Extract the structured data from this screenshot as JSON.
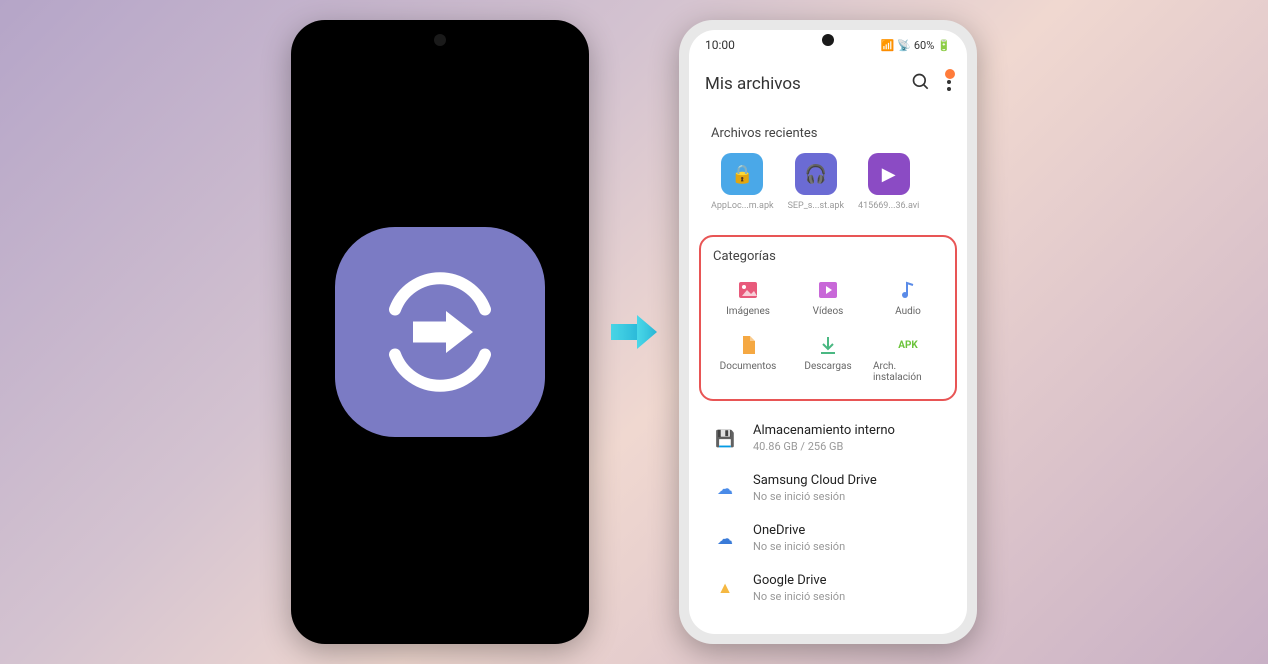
{
  "status": {
    "time": "10:00",
    "battery": "60%",
    "signal": "📶",
    "wifi": "📡",
    "battery_icon": "🔋"
  },
  "header": {
    "title": "Mis archivos"
  },
  "recent": {
    "title": "Archivos recientes",
    "items": [
      {
        "label": "AppLoc...m.apk",
        "color": "#4aa8e8",
        "glyph": "🔒"
      },
      {
        "label": "SEP_s...st.apk",
        "color": "#6b6bd4",
        "glyph": "🎧"
      },
      {
        "label": "415669...36.avi",
        "color": "#8b4bc4",
        "glyph": "▶"
      }
    ]
  },
  "categories": {
    "title": "Categorías",
    "items": [
      {
        "label": "Imágenes",
        "color": "#e85a7b",
        "type": "image"
      },
      {
        "label": "Vídeos",
        "color": "#c868d8",
        "type": "video"
      },
      {
        "label": "Audio",
        "color": "#5a8be8",
        "type": "audio"
      },
      {
        "label": "Documentos",
        "color": "#f5a842",
        "type": "doc"
      },
      {
        "label": "Descargas",
        "color": "#4ab882",
        "type": "download"
      },
      {
        "label": "Arch. instalación",
        "color": "#6bc43a",
        "type": "apk",
        "text": "APK"
      }
    ]
  },
  "storage": {
    "items": [
      {
        "title": "Almacenamiento interno",
        "sub": "40.86 GB / 256 GB",
        "color": "#5a9be8",
        "glyph": "💾"
      },
      {
        "title": "Samsung Cloud Drive",
        "sub": "No se inició sesión",
        "color": "#4a8be8",
        "glyph": "☁"
      },
      {
        "title": "OneDrive",
        "sub": "No se inició sesión",
        "color": "#3a7bd8",
        "glyph": "☁"
      },
      {
        "title": "Google Drive",
        "sub": "No se inició sesión",
        "color": "#f5b842",
        "glyph": "▲"
      }
    ]
  }
}
